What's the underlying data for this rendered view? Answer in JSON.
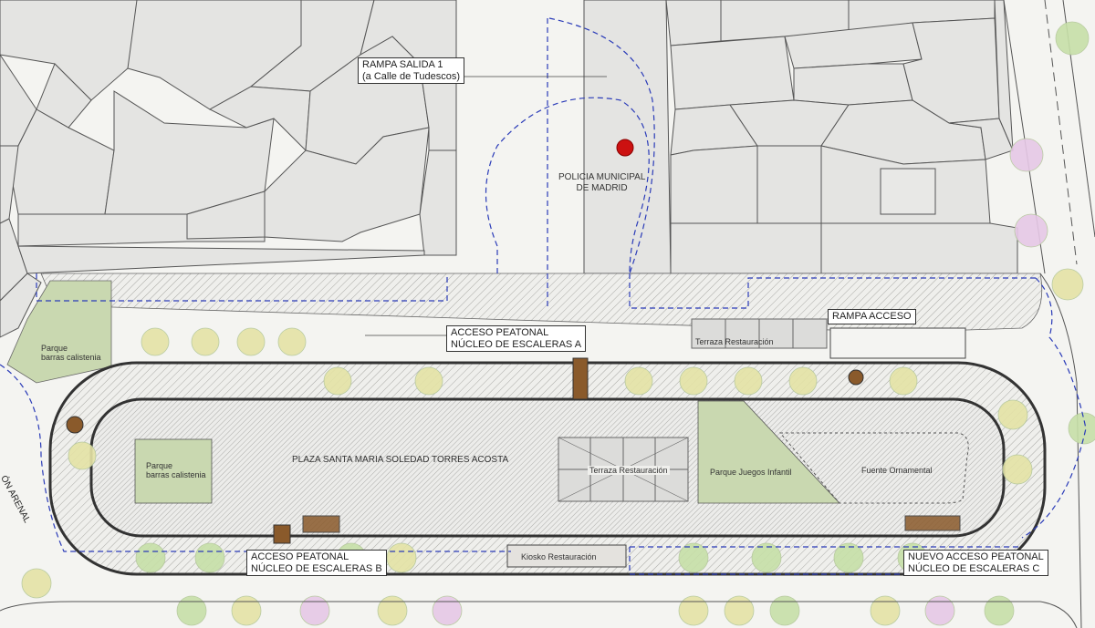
{
  "labels": {
    "rampa_salida_1": "RAMPA SALIDA 1",
    "rampa_salida_1_sub": "(a Calle de Tudescos)",
    "policia_line1": "POLICIA MUNICIPAL",
    "policia_line2": "DE MADRID",
    "rampa_acceso": "RAMPA ACCESO",
    "acceso_a_line1": "ACCESO PEATONAL",
    "acceso_a_line2": "NÚCLEO DE ESCALERAS A",
    "terraza_top": "Terraza Restauración",
    "parque_calistenia_left_1": "Parque",
    "parque_calistenia_left_2": "barras calistenia",
    "parque_calistenia_inner_1": "Parque",
    "parque_calistenia_inner_2": "barras calistenia",
    "plaza_name": "PLAZA SANTA MARIA SOLEDAD TORRES ACOSTA",
    "terraza_center": "Terraza Restauración",
    "parque_juegos": "Parque Juegos Infantil",
    "fuente": "Fuente Ornamental",
    "kiosko": "Kiosko Restauración",
    "acceso_b_line1": "ACCESO PEATONAL",
    "acceso_b_line2": "NÚCLEO DE ESCALERAS B",
    "acceso_c_line1": "NUEVO ACCESO PEATONAL",
    "acceso_c_line2": "NÚCLEO DE ESCALERAS C",
    "street_arenal": "ÓN ARENAL"
  },
  "colors": {
    "building_fill": "#e4e4e2",
    "building_stroke": "#555555",
    "plaza_hatch": "#9a9a9a",
    "green_area": "#c9d8b0",
    "tree_green": "#c7e0a8",
    "tree_yellow": "#e5e3a6",
    "tree_pink": "#e6c8e6",
    "dashed_blue": "#2a3bb8",
    "marker_red": "#cc1111",
    "stairs_brown": "#8a5a2b"
  }
}
